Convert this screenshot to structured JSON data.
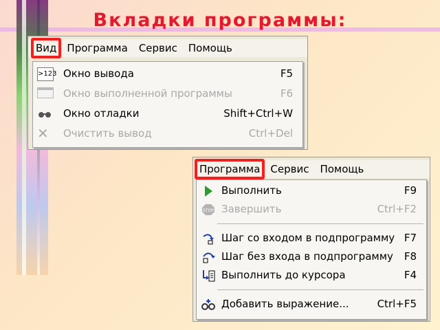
{
  "title": "Вкладки  программы:",
  "menu1": {
    "items": [
      "Вид",
      "Программа",
      "Сервис",
      "Помощь"
    ],
    "dropdown": [
      {
        "label": "Окно вывода",
        "shortcut": "F5",
        "icon": "output-window-icon",
        "disabled": false
      },
      {
        "label": "Окно выполненной программы",
        "shortcut": "F6",
        "icon": "window-icon",
        "disabled": true
      },
      {
        "label": "Окно отладки",
        "shortcut": "Shift+Ctrl+W",
        "icon": "debug-glasses-icon",
        "disabled": false
      },
      {
        "label": "Очистить вывод",
        "shortcut": "Ctrl+Del",
        "icon": "clear-icon",
        "disabled": true
      }
    ]
  },
  "menu2": {
    "items": [
      "Программа",
      "Сервис",
      "Помощь"
    ],
    "dropdown": [
      {
        "label": "Выполнить",
        "shortcut": "F9",
        "icon": "run-icon",
        "disabled": false
      },
      {
        "label": "Завершить",
        "shortcut": "Ctrl+F2",
        "icon": "stop-icon",
        "disabled": true
      },
      {
        "label": "Шаг со входом в подпрограмму",
        "shortcut": "F7",
        "icon": "step-into-icon",
        "disabled": false
      },
      {
        "label": "Шаг без входа в подпрограмму",
        "shortcut": "F8",
        "icon": "step-over-icon",
        "disabled": false
      },
      {
        "label": "Выполнить до курсора",
        "shortcut": "F4",
        "icon": "run-to-cursor-icon",
        "disabled": false
      },
      {
        "label": "Добавить выражение...",
        "shortcut": "Ctrl+F5",
        "icon": "add-watch-icon",
        "disabled": false
      }
    ]
  }
}
